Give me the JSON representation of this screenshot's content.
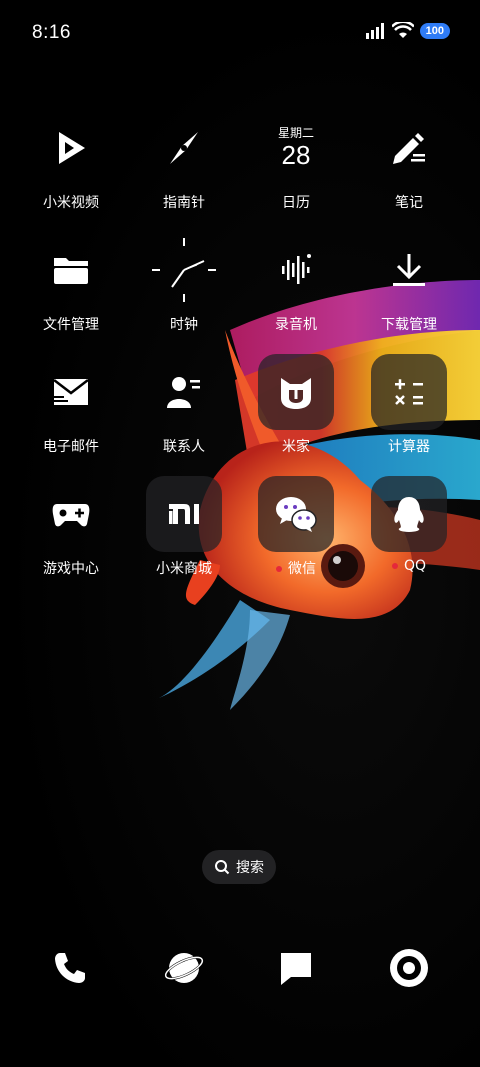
{
  "status_bar": {
    "time": "8:16",
    "battery": "100",
    "icons": [
      "signal-icon",
      "wifi-icon",
      "battery-icon"
    ]
  },
  "apps": [
    {
      "label": "小米视频",
      "icon": "play-icon"
    },
    {
      "label": "指南针",
      "icon": "compass-icon"
    },
    {
      "label": "日历",
      "icon": "calendar-icon",
      "weekday": "星期二",
      "day": "28"
    },
    {
      "label": "笔记",
      "icon": "notes-icon"
    },
    {
      "label": "文件管理",
      "icon": "folder-icon"
    },
    {
      "label": "时钟",
      "icon": "clock-icon"
    },
    {
      "label": "录音机",
      "icon": "recorder-icon"
    },
    {
      "label": "下载管理",
      "icon": "download-icon"
    },
    {
      "label": "电子邮件",
      "icon": "mail-icon"
    },
    {
      "label": "联系人",
      "icon": "contacts-icon"
    },
    {
      "label": "米家",
      "icon": "mijia-icon"
    },
    {
      "label": "计算器",
      "icon": "calculator-icon"
    },
    {
      "label": "游戏中心",
      "icon": "gamepad-icon"
    },
    {
      "label": "小米商城",
      "icon": "mi-store-icon"
    },
    {
      "label": "微信",
      "icon": "wechat-icon",
      "new_dot": true
    },
    {
      "label": "QQ",
      "icon": "qq-icon",
      "new_dot": true
    }
  ],
  "search": {
    "label": "搜索",
    "icon": "search-icon"
  },
  "dock": [
    {
      "icon": "phone-icon"
    },
    {
      "icon": "browser-icon"
    },
    {
      "icon": "messages-icon"
    },
    {
      "icon": "camera-icon"
    }
  ],
  "colors": {
    "battery": "#2f7cf6",
    "badge_dot": "#e5283a"
  }
}
